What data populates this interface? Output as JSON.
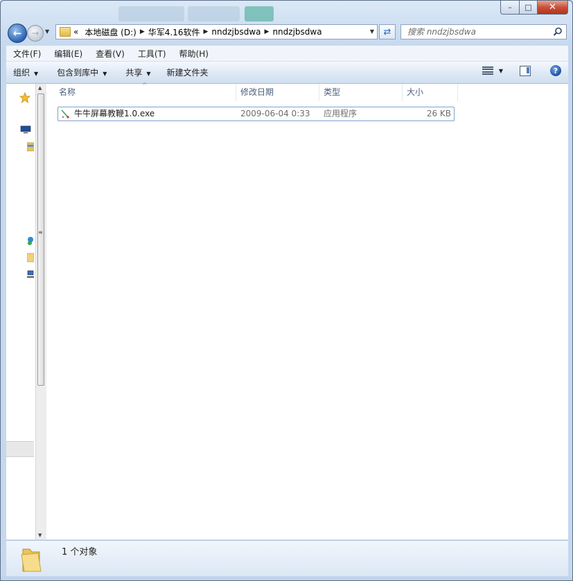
{
  "window": {
    "controls": {
      "minimize": "–",
      "maximize": "□",
      "close": "✕"
    }
  },
  "navigation": {
    "back_icon": "back-arrow-icon",
    "forward_icon": "forward-arrow-icon",
    "breadcrumb_overflow": "«",
    "breadcrumb": [
      "本地磁盘 (D:)",
      "华军4.16软件",
      "nndzjbsdwa",
      "nndzjbsdwa"
    ],
    "search_placeholder": "搜索 nndzjbsdwa"
  },
  "menu": {
    "items": [
      "文件(F)",
      "编辑(E)",
      "查看(V)",
      "工具(T)",
      "帮助(H)"
    ]
  },
  "toolbar": {
    "organize": "组织",
    "include_library": "包含到库中",
    "share": "共享",
    "new_folder": "新建文件夹"
  },
  "file_list": {
    "columns": {
      "name": "名称",
      "modified": "修改日期",
      "type": "类型",
      "size": "大小"
    },
    "rows": [
      {
        "name": "牛牛屏幕教鞭1.0.exe",
        "modified": "2009-06-04 0:33",
        "type": "应用程序",
        "size": "26 KB"
      }
    ]
  },
  "status": {
    "count": "1 个对象"
  },
  "colors": {
    "accent": "#2a63b4",
    "selection_border": "#7da2ce",
    "window_frame": "#c5d8ee"
  }
}
